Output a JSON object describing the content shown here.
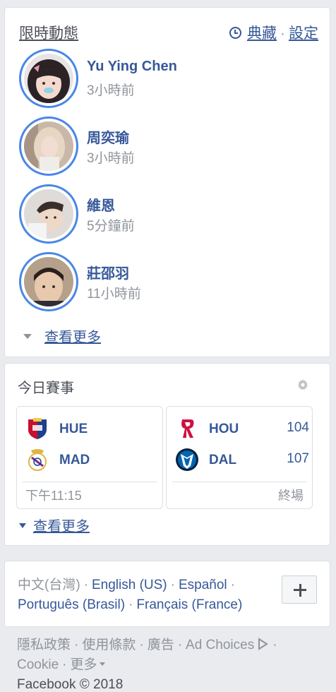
{
  "stories": {
    "title": "限時動態",
    "archive_label": "典藏",
    "settings_label": "設定",
    "separator": "·",
    "items": [
      {
        "name": "Yu Ying Chen",
        "time": "3小時前"
      },
      {
        "name": "周奕瑜",
        "time": "3小時前"
      },
      {
        "name": "維恩",
        "time": "5分鐘前"
      },
      {
        "name": "莊邵羽",
        "time": "11小時前"
      }
    ],
    "see_more": "查看更多",
    "ring_color": "#4a87e6"
  },
  "games": {
    "title": "今日賽事",
    "matches": [
      {
        "home": {
          "abbr": "HUE",
          "score": "",
          "icon": "huesca-crest-icon"
        },
        "away": {
          "abbr": "MAD",
          "score": "",
          "icon": "real-madrid-crest-icon"
        },
        "status": "下午11:15"
      },
      {
        "home": {
          "abbr": "HOU",
          "score": "104",
          "icon": "rockets-logo-icon"
        },
        "away": {
          "abbr": "DAL",
          "score": "107",
          "icon": "mavericks-logo-icon"
        },
        "status": "終場"
      }
    ],
    "see_more": "查看更多"
  },
  "languages": {
    "current": "中文(台灣)",
    "options": [
      "English (US)",
      "Español",
      "Português (Brasil)",
      "Français (France)"
    ],
    "add_label": "+"
  },
  "footer": {
    "links": [
      "隱私政策",
      "使用條款",
      "廣告",
      "Ad Choices",
      "Cookie",
      "更多"
    ],
    "copyright": "Facebook © 2018"
  },
  "colors": {
    "link": "#365899",
    "muted": "#90949c",
    "background": "#e9ebee"
  }
}
